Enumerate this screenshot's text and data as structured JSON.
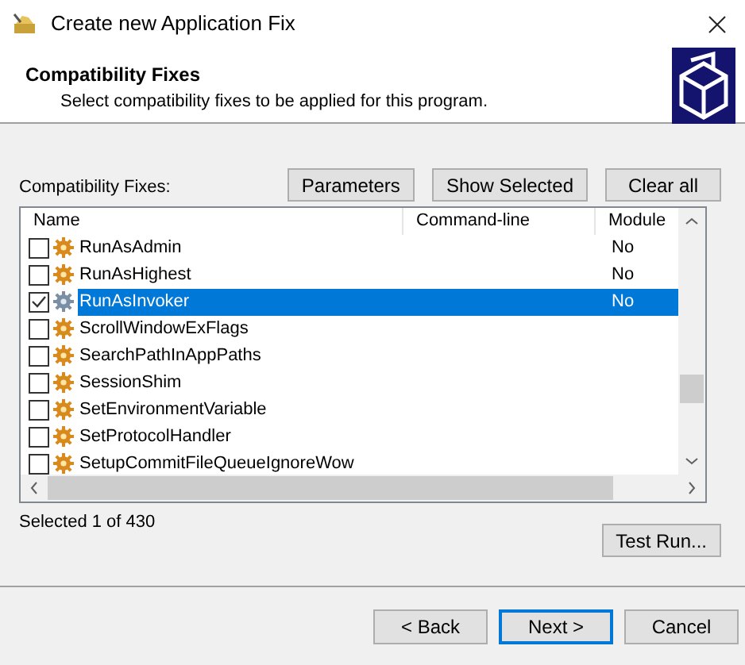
{
  "window": {
    "title": "Create new Application Fix"
  },
  "header": {
    "title": "Compatibility Fixes",
    "subtitle": "Select compatibility fixes to be applied for this program."
  },
  "fixes_label": "Compatibility Fixes:",
  "toolbar_buttons": [
    "Parameters",
    "Show Selected",
    "Clear all"
  ],
  "table": {
    "columns": [
      "Name",
      "Command-line",
      "Module"
    ],
    "rows": [
      {
        "name": "RunAsAdmin",
        "module": "No",
        "checked": false,
        "selected": false
      },
      {
        "name": "RunAsHighest",
        "module": "No",
        "checked": false,
        "selected": false
      },
      {
        "name": "RunAsInvoker",
        "module": "No",
        "checked": true,
        "selected": true
      },
      {
        "name": "ScrollWindowExFlags",
        "checked": false,
        "selected": false
      },
      {
        "name": "SearchPathInAppPaths",
        "checked": false,
        "selected": false
      },
      {
        "name": "SessionShim",
        "checked": false,
        "selected": false
      },
      {
        "name": "SetEnvironmentVariable",
        "checked": false,
        "selected": false
      },
      {
        "name": "SetProtocolHandler",
        "checked": false,
        "selected": false
      },
      {
        "name": "SetupCommitFileQueueIgnoreWow",
        "checked": false,
        "selected": false
      }
    ]
  },
  "status": "Selected 1 of 430",
  "test_button": "Test Run...",
  "footer_buttons": [
    {
      "label": "< Back",
      "default": false
    },
    {
      "label": "Next >",
      "default": true
    },
    {
      "label": "Cancel",
      "default": false
    }
  ]
}
